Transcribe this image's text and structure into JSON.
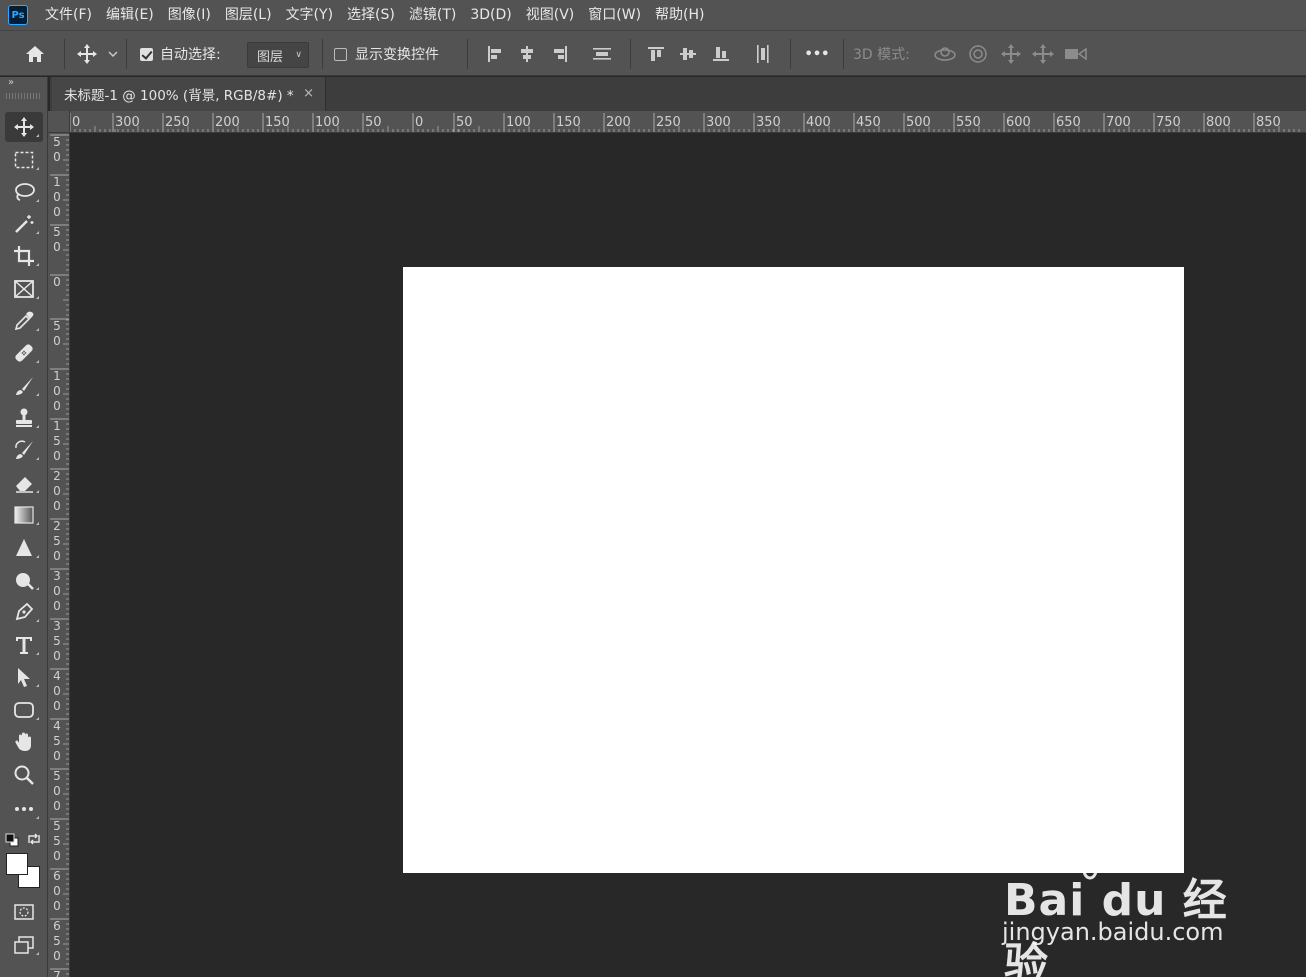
{
  "app": {
    "logo_text": "Ps"
  },
  "menu": [
    "文件(F)",
    "编辑(E)",
    "图像(I)",
    "图层(L)",
    "文字(Y)",
    "选择(S)",
    "滤镜(T)",
    "3D(D)",
    "视图(V)",
    "窗口(W)",
    "帮助(H)"
  ],
  "options": {
    "auto_select_label": "自动选择:",
    "auto_select_checked": true,
    "layer_select_value": "图层",
    "show_transform_label": "显示变换控件",
    "show_transform_checked": false,
    "more_label": "•••",
    "mode_3d_label": "3D 模式:"
  },
  "tab": {
    "title": "未标题-1 @ 100% (背景, RGB/8#) *",
    "close": "×"
  },
  "ruler_top_labels": [
    "0",
    "300",
    "250",
    "200",
    "150",
    "100",
    "50",
    "0",
    "50",
    "100",
    "150",
    "200",
    "250",
    "300",
    "350",
    "400",
    "450",
    "500",
    "550",
    "600",
    "650",
    "700",
    "750",
    "800",
    "850"
  ],
  "ruler_left_labels": [
    "50",
    "100",
    "50",
    "0",
    "50",
    "100",
    "150",
    "200",
    "250",
    "300",
    "350",
    "400",
    "450",
    "500",
    "550",
    "600",
    "650",
    "7"
  ],
  "toolbar": {
    "collapse": "»",
    "tools": [
      "move-tool",
      "marquee-tool",
      "lasso-tool",
      "magic-wand-tool",
      "crop-tool",
      "frame-tool",
      "eyedropper-tool",
      "healing-brush-tool",
      "brush-tool",
      "stamp-tool",
      "history-brush-tool",
      "eraser-tool",
      "gradient-tool",
      "blur-tool",
      "dodge-tool",
      "pen-tool",
      "type-tool",
      "path-selection-tool",
      "rectangle-tool",
      "hand-tool",
      "zoom-tool",
      "edit-toolbar"
    ],
    "foreground_color": "#ffffff",
    "background_color": "#ffffff"
  },
  "canvas": {
    "background": "#ffffff"
  },
  "watermark": {
    "brand": "Bai du 经验",
    "url": "jingyan.baidu.com"
  }
}
